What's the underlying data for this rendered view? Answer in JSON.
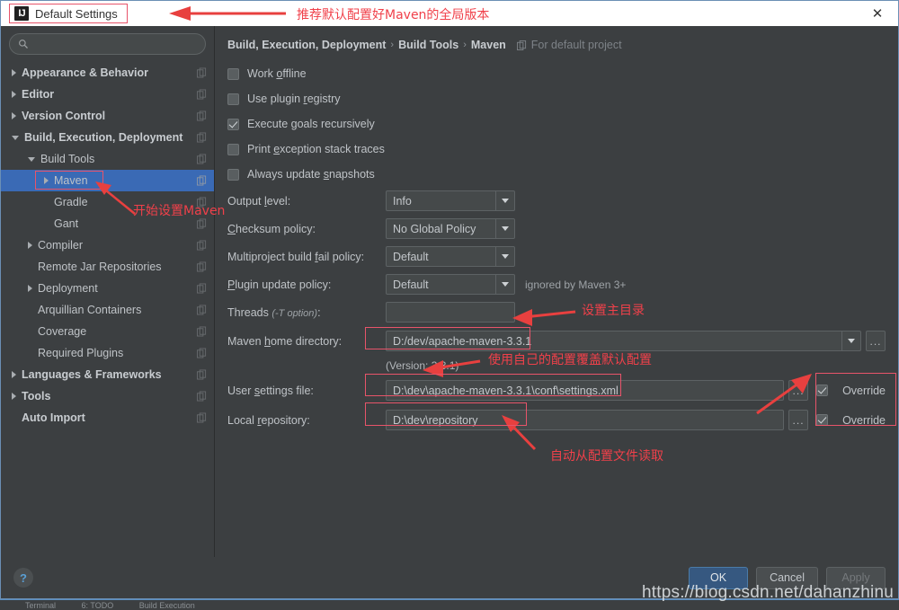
{
  "window": {
    "title": "Default Settings",
    "logo_text": "IJ",
    "close_label": "✕"
  },
  "search": {
    "value": "",
    "placeholder": ""
  },
  "sidebar": {
    "items": [
      {
        "label": "Appearance & Behavior",
        "indent": 0,
        "arrow": "right",
        "bold": true,
        "selected": false
      },
      {
        "label": "Editor",
        "indent": 0,
        "arrow": "right",
        "bold": true,
        "selected": false
      },
      {
        "label": "Version Control",
        "indent": 0,
        "arrow": "right",
        "bold": true,
        "selected": false
      },
      {
        "label": "Build, Execution, Deployment",
        "indent": 0,
        "arrow": "down",
        "bold": true,
        "selected": false
      },
      {
        "label": "Build Tools",
        "indent": 1,
        "arrow": "down",
        "bold": false,
        "selected": false
      },
      {
        "label": "Maven",
        "indent": 2,
        "arrow": "right",
        "bold": false,
        "selected": true
      },
      {
        "label": "Gradle",
        "indent": 2,
        "arrow": "none",
        "bold": false,
        "selected": false
      },
      {
        "label": "Gant",
        "indent": 2,
        "arrow": "none",
        "bold": false,
        "selected": false
      },
      {
        "label": "Compiler",
        "indent": 1,
        "arrow": "right",
        "bold": false,
        "selected": false
      },
      {
        "label": "Remote Jar Repositories",
        "indent": 1,
        "arrow": "none",
        "bold": false,
        "selected": false
      },
      {
        "label": "Deployment",
        "indent": 1,
        "arrow": "right",
        "bold": false,
        "selected": false
      },
      {
        "label": "Arquillian Containers",
        "indent": 1,
        "arrow": "none",
        "bold": false,
        "selected": false
      },
      {
        "label": "Coverage",
        "indent": 1,
        "arrow": "none",
        "bold": false,
        "selected": false
      },
      {
        "label": "Required Plugins",
        "indent": 1,
        "arrow": "none",
        "bold": false,
        "selected": false
      },
      {
        "label": "Languages & Frameworks",
        "indent": 0,
        "arrow": "right",
        "bold": true,
        "selected": false
      },
      {
        "label": "Tools",
        "indent": 0,
        "arrow": "right",
        "bold": true,
        "selected": false
      },
      {
        "label": "Auto Import",
        "indent": 0,
        "arrow": "none",
        "bold": true,
        "selected": false
      }
    ]
  },
  "breadcrumb": {
    "part1": "Build, Execution, Deployment",
    "sep1": "›",
    "part2": "Build Tools",
    "sep2": "›",
    "part3": "Maven",
    "note": "For default project"
  },
  "checkboxes": [
    {
      "label_pre": "Work ",
      "label_u": "o",
      "label_post": "ffline",
      "checked": false
    },
    {
      "label_pre": "Use plugin ",
      "label_u": "r",
      "label_post": "egistry",
      "checked": false
    },
    {
      "label_pre": "Execute ",
      "label_u": "g",
      "label_post": "oals recursively",
      "checked": true
    },
    {
      "label_pre": "Print ",
      "label_u": "e",
      "label_post": "xception stack traces",
      "checked": false
    },
    {
      "label_pre": "Always update ",
      "label_u": "s",
      "label_post": "napshots",
      "checked": false
    }
  ],
  "fields": {
    "output_level": {
      "label_pre": "Output ",
      "label_u": "l",
      "label_post": "evel:",
      "value": "Info"
    },
    "checksum_policy": {
      "label_pre": "",
      "label_u": "C",
      "label_post": "hecksum policy:",
      "value": "No Global Policy"
    },
    "multiproject_fail": {
      "label_pre": "Multiproject build ",
      "label_u": "f",
      "label_post": "ail policy:",
      "value": "Default"
    },
    "plugin_update": {
      "label_pre": "",
      "label_u": "P",
      "label_post": "lugin update policy:",
      "value": "Default",
      "hint": "ignored by Maven 3+"
    },
    "threads": {
      "label_pre": "Threads ",
      "label_italic": "(-T option)",
      "label_post": ":",
      "value": ""
    },
    "maven_home": {
      "label_pre": "Maven ",
      "label_u": "h",
      "label_post": "ome directory:",
      "value": "D:/dev/apache-maven-3.3.1"
    },
    "version_line": "(Version: 3.3.1)",
    "user_settings": {
      "label_pre": "User ",
      "label_u": "s",
      "label_post": "ettings file:",
      "value": "D:\\dev\\apache-maven-3.3.1\\conf\\settings.xml",
      "override_label": "Override",
      "override_checked": true
    },
    "local_repository": {
      "label_pre": "Local ",
      "label_u": "r",
      "label_post": "epository:",
      "value": "D:\\dev\\repository",
      "override_label": "Override",
      "override_checked": true
    },
    "browse_label": "..."
  },
  "annotations": [
    {
      "id": "anno-top",
      "text": "推荐默认配置好Maven的全局版本"
    },
    {
      "id": "anno-maven",
      "text": "开始设置Maven"
    },
    {
      "id": "anno-home",
      "text": "设置主目录"
    },
    {
      "id": "anno-override",
      "text": "使用自己的配置覆盖默认配置"
    },
    {
      "id": "anno-auto",
      "text": "自动从配置文件读取"
    }
  ],
  "footer": {
    "help_label": "?",
    "ok_label": "OK",
    "cancel_label": "Cancel",
    "apply_label": "Apply"
  },
  "watermark": "https://blog.csdn.net/dahanzhinu",
  "ide_strip": [
    "Terminal",
    "6: TODO",
    "Build Execution"
  ],
  "colors": {
    "accent_blue": "#3a6ab5",
    "annotation_red": "#f0404a",
    "panel_bg": "#3c3f41",
    "field_bg": "#45494a"
  }
}
